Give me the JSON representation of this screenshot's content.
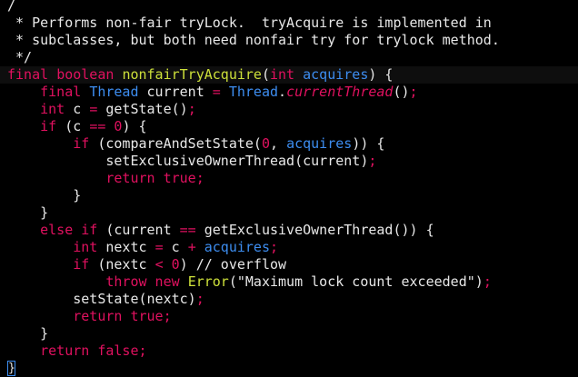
{
  "theme": {
    "background": "#000000",
    "keyword_color": "#e0115f",
    "type_color": "#3d8df0",
    "function_color": "#cde03a",
    "text_color": "#e8e8e8"
  },
  "lines": [
    {
      "tokens": [
        {
          "t": "/",
          "c": "comment"
        }
      ]
    },
    {
      "tokens": [
        {
          "t": " * Performs non-fair tryLock.  tryAcquire is implemented in",
          "c": "comment"
        }
      ]
    },
    {
      "tokens": [
        {
          "t": " * subclasses, but both need nonfair try for trylock method.",
          "c": "comment"
        }
      ]
    },
    {
      "tokens": [
        {
          "t": " */",
          "c": "comment"
        }
      ]
    },
    {
      "tokens": [
        {
          "t": "final",
          "c": "keyword"
        },
        {
          "t": " ",
          "c": "plain"
        },
        {
          "t": "boolean",
          "c": "keyword"
        },
        {
          "t": " ",
          "c": "plain"
        },
        {
          "t": "nonfairTryAcquire",
          "c": "func"
        },
        {
          "t": "(",
          "c": "plain"
        },
        {
          "t": "int",
          "c": "keyword"
        },
        {
          "t": " ",
          "c": "plain"
        },
        {
          "t": "acquires",
          "c": "type"
        },
        {
          "t": ") {",
          "c": "plain"
        }
      ]
    },
    {
      "tokens": [
        {
          "t": "    ",
          "c": "plain"
        },
        {
          "t": "final",
          "c": "keyword"
        },
        {
          "t": " ",
          "c": "plain"
        },
        {
          "t": "Thread",
          "c": "type"
        },
        {
          "t": " current ",
          "c": "plain"
        },
        {
          "t": "=",
          "c": "op"
        },
        {
          "t": " ",
          "c": "plain"
        },
        {
          "t": "Thread",
          "c": "type"
        },
        {
          "t": ".",
          "c": "plain"
        },
        {
          "t": "currentThread",
          "c": "static"
        },
        {
          "t": "()",
          "c": "plain"
        },
        {
          "t": ";",
          "c": "op"
        }
      ]
    },
    {
      "tokens": [
        {
          "t": "    ",
          "c": "plain"
        },
        {
          "t": "int",
          "c": "keyword"
        },
        {
          "t": " c ",
          "c": "plain"
        },
        {
          "t": "=",
          "c": "op"
        },
        {
          "t": " getState()",
          "c": "plain"
        },
        {
          "t": ";",
          "c": "op"
        }
      ]
    },
    {
      "tokens": [
        {
          "t": "    ",
          "c": "plain"
        },
        {
          "t": "if",
          "c": "keyword"
        },
        {
          "t": " (c ",
          "c": "plain"
        },
        {
          "t": "==",
          "c": "op"
        },
        {
          "t": " ",
          "c": "plain"
        },
        {
          "t": "0",
          "c": "num"
        },
        {
          "t": ") {",
          "c": "plain"
        }
      ]
    },
    {
      "tokens": [
        {
          "t": "        ",
          "c": "plain"
        },
        {
          "t": "if",
          "c": "keyword"
        },
        {
          "t": " (compareAndSetState(",
          "c": "plain"
        },
        {
          "t": "0",
          "c": "num"
        },
        {
          "t": ", ",
          "c": "plain"
        },
        {
          "t": "acquires",
          "c": "type"
        },
        {
          "t": ")) {",
          "c": "plain"
        }
      ]
    },
    {
      "tokens": [
        {
          "t": "            setExclusiveOwnerThread(current)",
          "c": "plain"
        },
        {
          "t": ";",
          "c": "op"
        }
      ]
    },
    {
      "tokens": [
        {
          "t": "            ",
          "c": "plain"
        },
        {
          "t": "return true",
          "c": "keyword"
        },
        {
          "t": ";",
          "c": "op"
        }
      ]
    },
    {
      "tokens": [
        {
          "t": "        }",
          "c": "plain"
        }
      ]
    },
    {
      "tokens": [
        {
          "t": "    }",
          "c": "plain"
        }
      ]
    },
    {
      "tokens": [
        {
          "t": "    ",
          "c": "plain"
        },
        {
          "t": "else if",
          "c": "keyword"
        },
        {
          "t": " (current ",
          "c": "plain"
        },
        {
          "t": "==",
          "c": "op"
        },
        {
          "t": " getExclusiveOwnerThread()) {",
          "c": "plain"
        }
      ]
    },
    {
      "tokens": [
        {
          "t": "        ",
          "c": "plain"
        },
        {
          "t": "int",
          "c": "keyword"
        },
        {
          "t": " nextc ",
          "c": "plain"
        },
        {
          "t": "=",
          "c": "op"
        },
        {
          "t": " c ",
          "c": "plain"
        },
        {
          "t": "+",
          "c": "op"
        },
        {
          "t": " ",
          "c": "plain"
        },
        {
          "t": "acquires",
          "c": "type"
        },
        {
          "t": ";",
          "c": "op"
        }
      ]
    },
    {
      "tokens": [
        {
          "t": "        ",
          "c": "plain"
        },
        {
          "t": "if",
          "c": "keyword"
        },
        {
          "t": " (nextc ",
          "c": "plain"
        },
        {
          "t": "<",
          "c": "op"
        },
        {
          "t": " ",
          "c": "plain"
        },
        {
          "t": "0",
          "c": "num"
        },
        {
          "t": ") // overflow",
          "c": "plain"
        }
      ]
    },
    {
      "tokens": [
        {
          "t": "            ",
          "c": "plain"
        },
        {
          "t": "throw new",
          "c": "keyword"
        },
        {
          "t": " ",
          "c": "plain"
        },
        {
          "t": "Error",
          "c": "error"
        },
        {
          "t": "(\"Maximum lock count exceeded\")",
          "c": "plain"
        },
        {
          "t": ";",
          "c": "op"
        }
      ]
    },
    {
      "tokens": [
        {
          "t": "        setState(nextc)",
          "c": "plain"
        },
        {
          "t": ";",
          "c": "op"
        }
      ]
    },
    {
      "tokens": [
        {
          "t": "        ",
          "c": "plain"
        },
        {
          "t": "return true",
          "c": "keyword"
        },
        {
          "t": ";",
          "c": "op"
        }
      ]
    },
    {
      "tokens": [
        {
          "t": "    }",
          "c": "plain"
        }
      ]
    },
    {
      "tokens": [
        {
          "t": "    ",
          "c": "plain"
        },
        {
          "t": "return false",
          "c": "keyword"
        },
        {
          "t": ";",
          "c": "op"
        }
      ]
    },
    {
      "tokens": [
        {
          "t": "}",
          "c": "cursor"
        }
      ]
    }
  ]
}
